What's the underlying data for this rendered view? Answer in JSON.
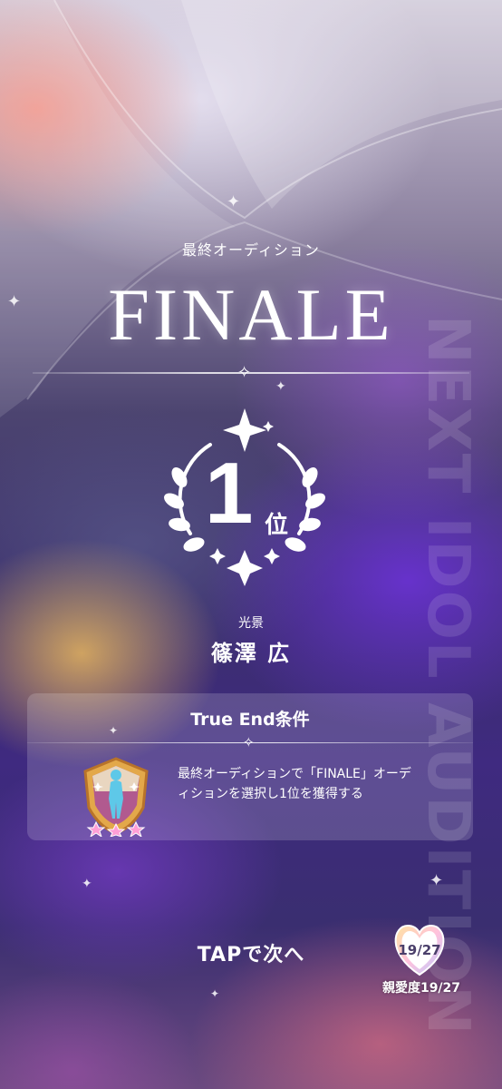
{
  "background": {
    "side_text": "NEXT IDOL AUDITION"
  },
  "header": {
    "subtitle": "最終オーディション",
    "title": "FINALE"
  },
  "result": {
    "rank_number": "1",
    "rank_suffix": "位"
  },
  "character": {
    "label": "光景",
    "name": "篠澤 広"
  },
  "true_end": {
    "title": "True End条件",
    "condition": "最終オーディションで「FINALE」オーディションを選択し1位を獲得する",
    "badge_icon": "idol-silhouette-badge-icon"
  },
  "footer": {
    "tap_text": "TAPで次へ",
    "affinity_value": "19/27",
    "affinity_label": "親愛度19/27"
  },
  "colors": {
    "text": "#ffffff",
    "accent_purple": "#5b2fc0",
    "badge_gold": "#e3a84a"
  }
}
